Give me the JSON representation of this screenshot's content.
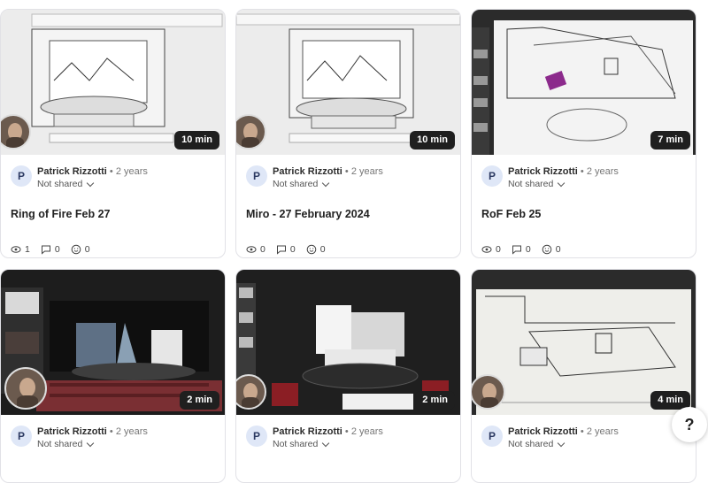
{
  "cards": [
    {
      "duration": "10 min",
      "author": "Patrick Rizzotti",
      "separator": "•",
      "age": "2 years",
      "sharing": "Not shared",
      "title": "Ring of Fire Feb 27",
      "views": "1",
      "comments": "0",
      "reactions": "0",
      "avatar_initial": "P"
    },
    {
      "duration": "10 min",
      "author": "Patrick Rizzotti",
      "separator": "•",
      "age": "2 years",
      "sharing": "Not shared",
      "title": "Miro - 27 February 2024",
      "views": "0",
      "comments": "0",
      "reactions": "0",
      "avatar_initial": "P"
    },
    {
      "duration": "7 min",
      "author": "Patrick Rizzotti",
      "separator": "•",
      "age": "2 years",
      "sharing": "Not shared",
      "title": "RoF Feb 25",
      "views": "0",
      "comments": "0",
      "reactions": "0",
      "avatar_initial": "P"
    },
    {
      "duration": "2 min",
      "author": "Patrick Rizzotti",
      "separator": "•",
      "age": "2 years",
      "sharing": "Not shared",
      "avatar_initial": "P"
    },
    {
      "duration": "2 min",
      "author": "Patrick Rizzotti",
      "separator": "•",
      "age": "2 years",
      "sharing": "Not shared",
      "avatar_initial": "P"
    },
    {
      "duration": "4 min",
      "author": "Patrick Rizzotti",
      "separator": "•",
      "age": "2 years",
      "sharing": "Not shared",
      "avatar_initial": "P"
    }
  ],
  "help_label": "?",
  "icons": {
    "views": "eye-icon",
    "comments": "comment-icon",
    "reactions": "smiley-icon",
    "sharing": "chevron-down-icon"
  }
}
